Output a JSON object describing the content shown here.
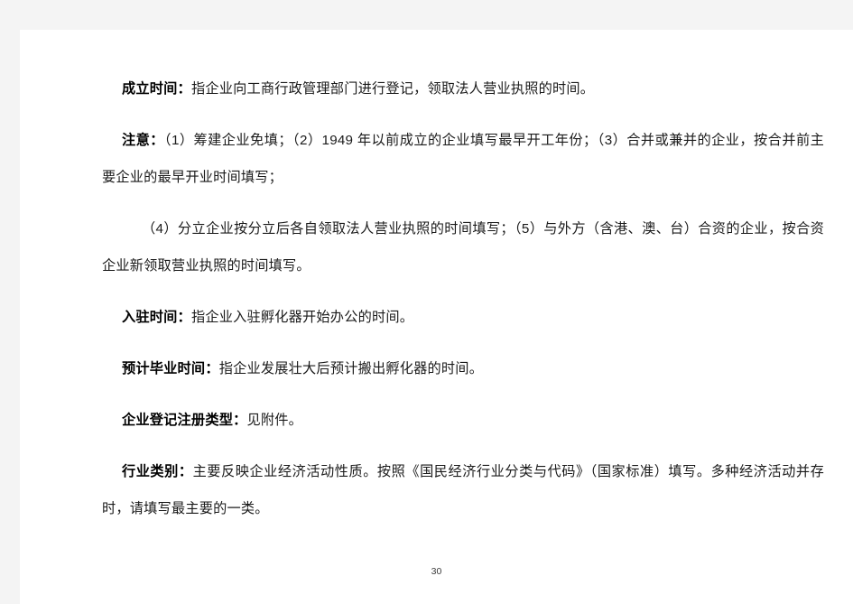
{
  "document": {
    "page_number": "30",
    "paragraphs": [
      {
        "id": "establishment-time",
        "term": "成立时间：",
        "text": "指企业向工商行政管理部门进行登记，领取法人营业执照的时间。",
        "indent": "single"
      },
      {
        "id": "notice",
        "term": "注意：",
        "text": "（1）筹建企业免填；（2）1949 年以前成立的企业填写最早开工年份；（3）合并或兼并的企业，按合并前主要企业的最早开业时间填写；",
        "indent": "single"
      },
      {
        "id": "notice-continued",
        "term": "",
        "text": "（4）分立企业按分立后各自领取法人营业执照的时间填写；（5）与外方（含港、澳、台）合资的企业，按合资企业新领取营业执照的时间填写。",
        "indent": "double"
      },
      {
        "id": "settle-in-time",
        "term": "入驻时间：",
        "text": "指企业入驻孵化器开始办公的时间。",
        "indent": "single"
      },
      {
        "id": "expected-graduation-time",
        "term": "预计毕业时间：",
        "text": "指企业发展壮大后预计搬出孵化器的时间。",
        "indent": "single"
      },
      {
        "id": "registration-type",
        "term": "企业登记注册类型：",
        "text": "见附件。",
        "indent": "single"
      },
      {
        "id": "industry-category",
        "term": "行业类别：",
        "text": "主要反映企业经济活动性质。按照《国民经济行业分类与代码》（国家标准）填写。多种经济活动并存时，请填写最主要的一类。",
        "indent": "single"
      }
    ]
  }
}
